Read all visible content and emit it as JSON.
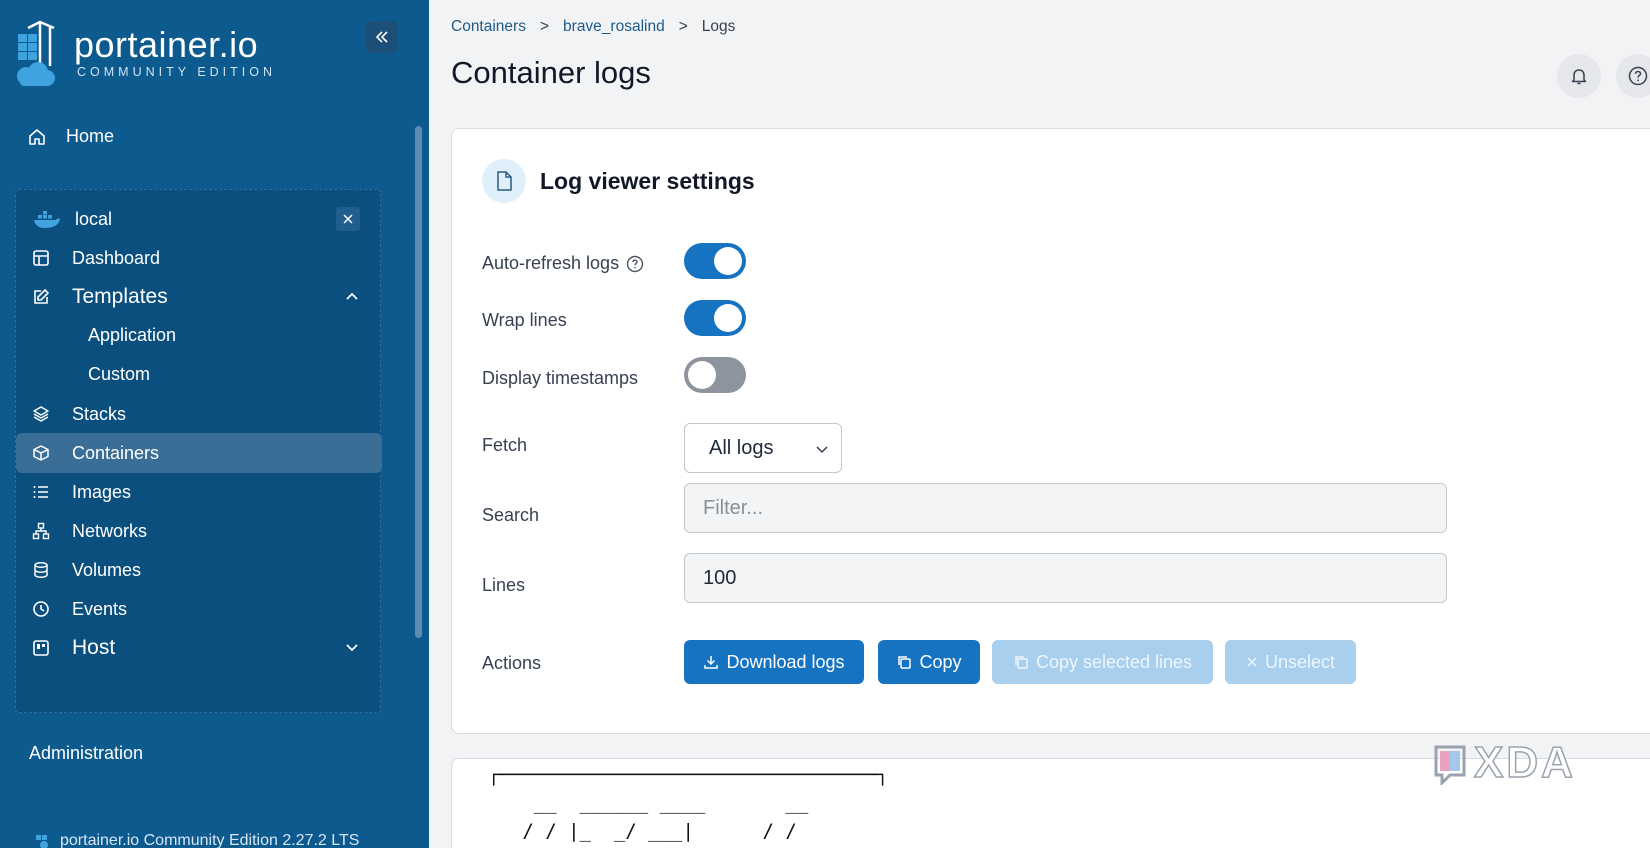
{
  "sidebar": {
    "logo": {
      "title": "portainer.io",
      "subtitle": "COMMUNITY EDITION"
    },
    "home_label": "Home",
    "environment": {
      "name": "local"
    },
    "items": [
      {
        "label": "Dashboard",
        "icon": "dashboard-icon"
      },
      {
        "label": "Templates",
        "icon": "edit-icon",
        "expanded": true
      },
      {
        "label": "Application"
      },
      {
        "label": "Custom"
      },
      {
        "label": "Stacks",
        "icon": "layers-icon"
      },
      {
        "label": "Containers",
        "icon": "box-icon",
        "active": true
      },
      {
        "label": "Images",
        "icon": "list-icon"
      },
      {
        "label": "Networks",
        "icon": "network-icon"
      },
      {
        "label": "Volumes",
        "icon": "database-icon"
      },
      {
        "label": "Events",
        "icon": "clock-icon"
      },
      {
        "label": "Host",
        "icon": "server-icon",
        "expanded": false
      }
    ],
    "administration_label": "Administration",
    "footer": "portainer.io Community Edition 2.27.2 LTS"
  },
  "breadcrumb": {
    "items": [
      "Containers",
      "brave_rosalind",
      "Logs"
    ],
    "separator": ">"
  },
  "page_title": "Container logs",
  "settings": {
    "title": "Log viewer settings",
    "auto_refresh": {
      "label": "Auto-refresh logs",
      "on": true
    },
    "wrap_lines": {
      "label": "Wrap lines",
      "on": true
    },
    "timestamps": {
      "label": "Display timestamps",
      "on": false
    },
    "fetch": {
      "label": "Fetch",
      "value": "All logs"
    },
    "search": {
      "label": "Search",
      "placeholder": "Filter...",
      "value": ""
    },
    "lines": {
      "label": "Lines",
      "value": "100"
    },
    "actions": {
      "label": "Actions",
      "download": "Download logs",
      "copy": "Copy",
      "copy_selected": "Copy selected lines",
      "unselect": "Unselect"
    }
  },
  "log_output": "┌─────────────────────────────────┐\n    __  ______ ____       __\n   / / |_  _/ ___|      / /\n  / /    | || |  __    / /",
  "watermark": "XDA",
  "colors": {
    "sidebar_bg": "#0d5a8f",
    "primary": "#1573c2",
    "primary_disabled": "#a9cfee",
    "toggle_off": "#8d949e"
  }
}
